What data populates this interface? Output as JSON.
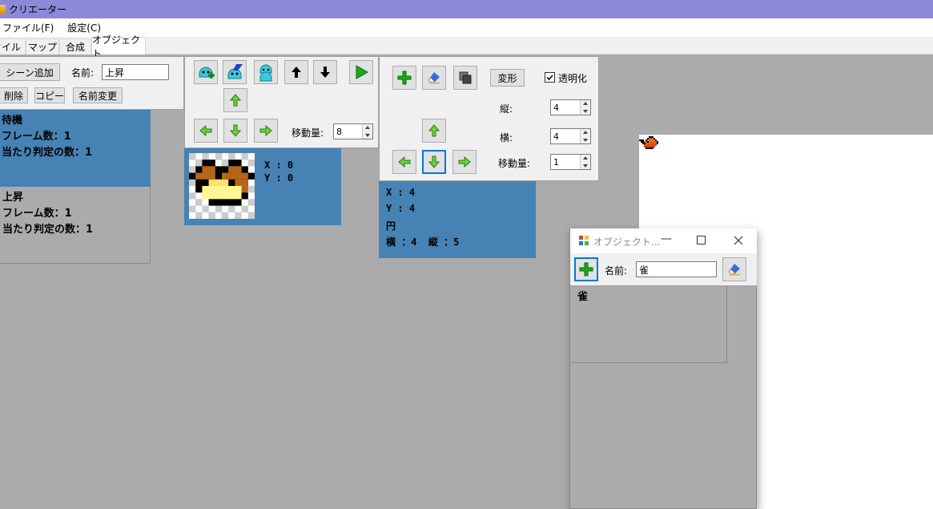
{
  "window": {
    "title": "クリエーター"
  },
  "menu": [
    "ファイル(F)",
    "設定(C)"
  ],
  "tabs": [
    {
      "label": "タイル",
      "active": false
    },
    {
      "label": "マップ",
      "active": false
    },
    {
      "label": "合成",
      "active": false
    },
    {
      "label": "オブジェクト",
      "active": true
    }
  ],
  "scene_panel": {
    "add_scene": "シーン追加",
    "name_label": "名前:",
    "name_value": "上昇",
    "delete": "削除",
    "copy": "コピー",
    "rename": "名前変更"
  },
  "scenes": [
    {
      "name": "待機",
      "frames": "フレーム数：1",
      "hitboxes": "当たり判定の数：1",
      "selected": true
    },
    {
      "name": "上昇",
      "frames": "フレーム数：1",
      "hitboxes": "当たり判定の数：1",
      "selected": false
    }
  ],
  "frame_panel": {
    "move_label": "移動量:",
    "move_value": "8"
  },
  "frame_card": {
    "x": "X : 0",
    "y": "Y : 0"
  },
  "hitbox_panel": {
    "transform": "変形",
    "transparent": "透明化",
    "transparent_checked": true,
    "height_label": "縦:",
    "height_value": "4",
    "width_label": "横:",
    "width_value": "4",
    "move_label": "移動量:",
    "move_value": "1"
  },
  "hitbox_card": {
    "x": "X : 4",
    "y": "Y : 4",
    "shape": "円",
    "size": "横 ：4  縦 ：5"
  },
  "object_window": {
    "title": "オブジェクト...",
    "name_label": "名前:",
    "name_value": "雀",
    "items": [
      "雀"
    ]
  },
  "colors": {
    "selected_card": "#4682b4",
    "title_bar": "#8b89d8"
  },
  "icons": [
    "frame-add-icon",
    "frame-erase-icon",
    "frame-copy-icon",
    "arrow-up-icon",
    "arrow-down-icon",
    "play-icon",
    "plus-icon",
    "eraser-icon",
    "duplicate-icon"
  ]
}
